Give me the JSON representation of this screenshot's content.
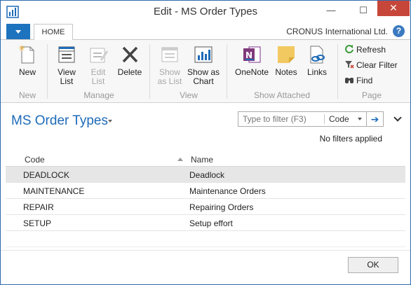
{
  "window": {
    "title": "Edit - MS Order Types",
    "minimize_glyph": "—",
    "maximize_glyph": "☐",
    "close_glyph": "✕"
  },
  "ribbon": {
    "menu_icon": "chevron-down-icon",
    "tab_home": "HOME",
    "company": "CRONUS International Ltd.",
    "help": "?",
    "groups": {
      "new": "New",
      "manage": "Manage",
      "view": "View",
      "show_attached": "Show Attached",
      "page": "Page"
    },
    "buttons": {
      "new": "New",
      "view_list_1": "View",
      "view_list_2": "List",
      "edit_list_1": "Edit",
      "edit_list_2": "List",
      "delete": "Delete",
      "show_as_list_1": "Show",
      "show_as_list_2": "as List",
      "show_as_chart_1": "Show as",
      "show_as_chart_2": "Chart",
      "onenote": "OneNote",
      "notes": "Notes",
      "links": "Links",
      "refresh": "Refresh",
      "clear_filter": "Clear Filter",
      "find": "Find"
    }
  },
  "list": {
    "title": "MS Order Types",
    "filter_placeholder": "Type to filter (F3)",
    "filter_field": "Code",
    "filter_go": "➔",
    "no_filters": "No filters applied",
    "columns": [
      "Code",
      "Name"
    ],
    "rows": [
      {
        "code": "DEADLOCK",
        "name": "Deadlock",
        "selected": true
      },
      {
        "code": "MAINTENANCE",
        "name": "Maintenance Orders",
        "selected": false
      },
      {
        "code": "REPAIR",
        "name": "Repairing Orders",
        "selected": false
      },
      {
        "code": "SETUP",
        "name": "Setup effort",
        "selected": false
      }
    ]
  },
  "footer": {
    "ok": "OK"
  },
  "colors": {
    "accent": "#1e6bb8",
    "close_red": "#c7463a",
    "selected_row": "#e6e6e6"
  }
}
